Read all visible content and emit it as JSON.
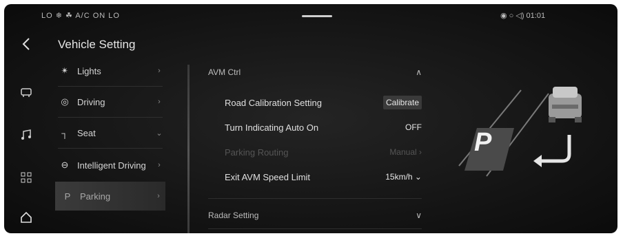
{
  "status_bar": {
    "left_text": "LO ❄ ☘ A/C ON  LO",
    "right_text": "◉ ○ ◁) 01:01"
  },
  "nav": {
    "back_icon": "chevron-left-icon",
    "rail_icons": [
      "seat-icon",
      "music-icon",
      "apps-icon",
      "home-icon"
    ]
  },
  "page_title": "Vehicle Setting",
  "menu": {
    "items": [
      {
        "icon": "light-icon",
        "glyph": "✴",
        "label": "Lights",
        "chevron": "›"
      },
      {
        "icon": "steering-icon",
        "glyph": "◎",
        "label": "Driving",
        "chevron": "›"
      },
      {
        "icon": "seat-icon",
        "glyph": "┐",
        "label": "Seat",
        "chevron": "⌄"
      },
      {
        "icon": "assist-icon",
        "glyph": "⊖",
        "label": "Intelligent Driving",
        "chevron": "›"
      },
      {
        "icon": "parking-icon",
        "glyph": "P",
        "label": "Parking",
        "chevron": "›"
      }
    ]
  },
  "content": {
    "section_avm": {
      "label": "AVM Ctrl",
      "chevron": "∧"
    },
    "rows": [
      {
        "label": "Road Calibration Setting",
        "value": "Calibrate"
      },
      {
        "label": "Turn Indicating Auto On",
        "value": "OFF"
      },
      {
        "label": "Parking Routing",
        "value": "Manual ›"
      },
      {
        "label": "Exit AVM Speed Limit",
        "value": "15km/h ⌄"
      }
    ],
    "section_radar": {
      "label": "Radar Setting",
      "chevron": "∨"
    }
  },
  "illustration": {
    "p_letter": "P",
    "return_arrow": "↲"
  }
}
